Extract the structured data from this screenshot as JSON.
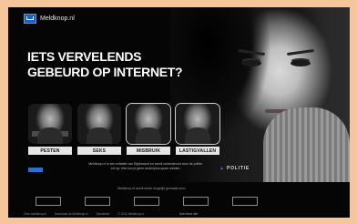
{
  "header": {
    "logo_text": "Meldknop.nl"
  },
  "hero": {
    "headline": [
      "IETS VERVELENDS",
      "GEBEURD OP INTERNET?"
    ]
  },
  "categories": [
    {
      "label": "PESTEN"
    },
    {
      "label": "SEKS"
    },
    {
      "label": "MISBRUIK"
    },
    {
      "label": "LASTIGVALLEN"
    }
  ],
  "info": {
    "badge_text": "",
    "text_line1": "Meldknop.nl is een initiatief van Digibewust en wordt ondersteund door de politie.",
    "text_line2": "Let op: hier kun je geen ander/plus spam melden.",
    "partner_logo_text": "POLITIE"
  },
  "note": "Meldknop.nl wordt mede mogelijk gemaakt door:",
  "partners": [
    "",
    "",
    "",
    "",
    ""
  ],
  "footer": {
    "links": [
      "Over meldknop.nl",
      "Download de Meldknop.nl",
      "Disclaimer",
      "© 2012 Meldknop.nl"
    ],
    "share": "Deel deze site"
  },
  "colors": {
    "accent": "#1f5fbf",
    "background": "#050505",
    "page_frame": "#f6c59c"
  }
}
